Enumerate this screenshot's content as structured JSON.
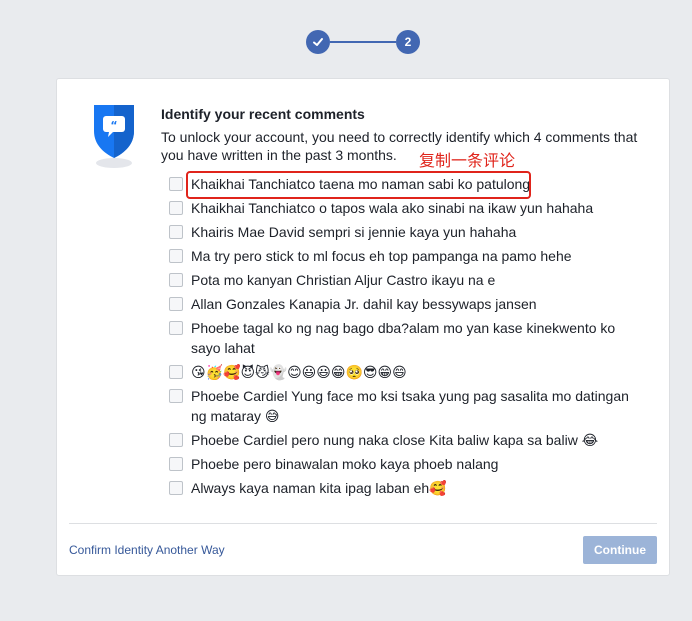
{
  "stepper": {
    "step1_icon": "checkmark-icon",
    "step2_label": "2",
    "active_color": "#4267b2"
  },
  "card": {
    "icon": "shield-comment-icon",
    "title": "Identify your recent comments",
    "description": "To unlock your account, you need to correctly identify which 4 comments that you have written in the past 3 months.",
    "options": [
      {
        "label": "Khaikhai Tanchiatco taena mo naman sabi ko patulong",
        "checked": false
      },
      {
        "label": "Khaikhai Tanchiatco o tapos wala ako sinabi na ikaw yun hahaha",
        "checked": false
      },
      {
        "label": "Khairis Mae David sempri si jennie kaya yun hahaha",
        "checked": false
      },
      {
        "label": "Ma try pero stick to ml focus eh top pampanga na pamo hehe",
        "checked": false
      },
      {
        "label": "Pota mo kanyan Christian Aljur Castro ikayu na e",
        "checked": false
      },
      {
        "label": "Allan Gonzales Kanapia Jr. dahil kay bessywaps jansen",
        "checked": false
      },
      {
        "label": "Phoebe tagal ko ng nag bago dba?alam mo yan kase kinekwento ko sayo lahat",
        "checked": false
      },
      {
        "label": "😘🥳🥰😈😼👻😊😃😃😁🥺😎😁😄",
        "checked": false
      },
      {
        "label": "Phoebe Cardiel Yung face mo ksi tsaka yung pag sasalita mo datingan ng mataray 😅",
        "checked": false
      },
      {
        "label": "Phoebe Cardiel pero nung naka close Kita baliw kapa sa baliw 😂",
        "checked": false
      },
      {
        "label": "Phoebe pero binawalan moko kaya phoeb nalang",
        "checked": false
      },
      {
        "label": "Always kaya naman kita ipag laban eh🥰",
        "checked": false
      }
    ],
    "annotation": {
      "text": "复制一条评论",
      "color": "#e0241b"
    },
    "footer": {
      "alt_link": "Confirm Identity Another Way",
      "continue_label": "Continue",
      "continue_color": "#9cb4d8"
    }
  }
}
